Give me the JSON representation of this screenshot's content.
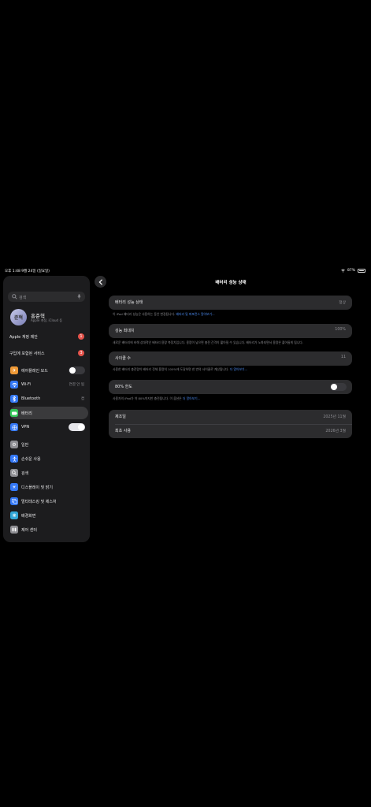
{
  "status_bar": {
    "time_date": "오후 1:48  9월 24일 (일요일)",
    "battery_percent": "87%",
    "battery_level": 0.87
  },
  "sidebar": {
    "search_placeholder": "검색",
    "profile": {
      "avatar_text": "준혁",
      "name": "홍준혁",
      "subtitle": "Apple 계정, iCloud 등"
    },
    "items": [
      {
        "label": "Apple 계정 제안",
        "badge": "1"
      },
      {
        "label": "구입에 포함된 서비스",
        "badge": "3"
      },
      {
        "label": "에어플레인 모드",
        "icon": "airplane-icon",
        "color": "#f09a37",
        "toggle": "off"
      },
      {
        "label": "Wi-Fi",
        "icon": "wifi-icon",
        "color": "#3478f6",
        "value": "연결 안 됨"
      },
      {
        "label": "Bluetooth",
        "icon": "bluetooth-icon",
        "color": "#3478f6",
        "value": "켬"
      },
      {
        "label": "배터리",
        "icon": "battery-icon",
        "color": "#34c759",
        "selected": true
      },
      {
        "label": "VPN",
        "icon": "vpn-icon",
        "color": "#3478f6",
        "toggle": "on"
      },
      {
        "label": "일반",
        "icon": "gear-icon",
        "color": "#8e8e93"
      },
      {
        "label": "손쉬운 사용",
        "icon": "accessibility-icon",
        "color": "#3478f6"
      },
      {
        "label": "검색",
        "icon": "search-icon",
        "color": "#8e8e93"
      },
      {
        "label": "디스플레이 및 밝기",
        "icon": "display-icon",
        "color": "#3478f6"
      },
      {
        "label": "멀티태스킹 및 제스처",
        "icon": "multitasking-icon",
        "color": "#3478f6"
      },
      {
        "label": "배경화면",
        "icon": "wallpaper-icon",
        "color": "#34a8d8"
      },
      {
        "label": "제어 센터",
        "icon": "control-center-icon",
        "color": "#8e8e93"
      }
    ]
  },
  "main": {
    "title": "배터리 성능 상태",
    "battery_health": {
      "label": "배터리 성능 상태",
      "value": "정상",
      "footnote": "이 iPad 배터리 성능은 사용하는 동안 변경됩니다.",
      "footnote_link": "배터리 및 퍼포먼스 알아보기..."
    },
    "max_capacity": {
      "label": "성능 최대치",
      "value": "100%",
      "footnote": "새로운 배터리에 비해 상대적인 배터리 용량 측정치입니다. 용량이 낮으면 충전 간격이 짧아질 수 있습니다. 배터리가 노화되면서 용량은 줄어들게 됩니다."
    },
    "cycle_count": {
      "label": "사이클 수",
      "value": "11",
      "footnote": "사용한 배터리 충전량이 배터리 전체 용량의 100%에 도달하면 한 번의 사이클로 계산됩니다.",
      "footnote_link": "더 알아보기..."
    },
    "limit_80": {
      "label": "80% 한도",
      "toggle": "off",
      "footnote": "사용자의 iPad가 약 80%까지만 충전됩니다. 이 옵션은",
      "footnote_link": "더 알아보기..."
    },
    "info": [
      {
        "label": "제조일",
        "value": "2025년 11월"
      },
      {
        "label": "최초 사용",
        "value": "2026년 3월"
      }
    ]
  }
}
